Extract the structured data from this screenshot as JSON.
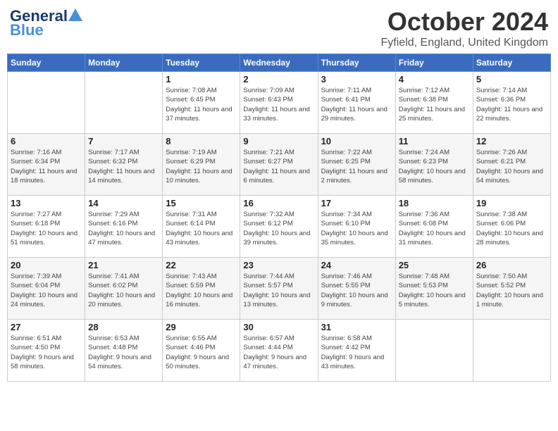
{
  "header": {
    "logo_general": "General",
    "logo_blue": "Blue",
    "month_title": "October 2024",
    "location": "Fyfield, England, United Kingdom"
  },
  "days_of_week": [
    "Sunday",
    "Monday",
    "Tuesday",
    "Wednesday",
    "Thursday",
    "Friday",
    "Saturday"
  ],
  "weeks": [
    [
      {
        "day": "",
        "info": ""
      },
      {
        "day": "",
        "info": ""
      },
      {
        "day": "1",
        "info": "Sunrise: 7:08 AM\nSunset: 6:45 PM\nDaylight: 11 hours\nand 37 minutes."
      },
      {
        "day": "2",
        "info": "Sunrise: 7:09 AM\nSunset: 6:43 PM\nDaylight: 11 hours\nand 33 minutes."
      },
      {
        "day": "3",
        "info": "Sunrise: 7:11 AM\nSunset: 6:41 PM\nDaylight: 11 hours\nand 29 minutes."
      },
      {
        "day": "4",
        "info": "Sunrise: 7:12 AM\nSunset: 6:38 PM\nDaylight: 11 hours\nand 25 minutes."
      },
      {
        "day": "5",
        "info": "Sunrise: 7:14 AM\nSunset: 6:36 PM\nDaylight: 11 hours\nand 22 minutes."
      }
    ],
    [
      {
        "day": "6",
        "info": "Sunrise: 7:16 AM\nSunset: 6:34 PM\nDaylight: 11 hours\nand 18 minutes."
      },
      {
        "day": "7",
        "info": "Sunrise: 7:17 AM\nSunset: 6:32 PM\nDaylight: 11 hours\nand 14 minutes."
      },
      {
        "day": "8",
        "info": "Sunrise: 7:19 AM\nSunset: 6:29 PM\nDaylight: 11 hours\nand 10 minutes."
      },
      {
        "day": "9",
        "info": "Sunrise: 7:21 AM\nSunset: 6:27 PM\nDaylight: 11 hours\nand 6 minutes."
      },
      {
        "day": "10",
        "info": "Sunrise: 7:22 AM\nSunset: 6:25 PM\nDaylight: 11 hours\nand 2 minutes."
      },
      {
        "day": "11",
        "info": "Sunrise: 7:24 AM\nSunset: 6:23 PM\nDaylight: 10 hours\nand 58 minutes."
      },
      {
        "day": "12",
        "info": "Sunrise: 7:26 AM\nSunset: 6:21 PM\nDaylight: 10 hours\nand 54 minutes."
      }
    ],
    [
      {
        "day": "13",
        "info": "Sunrise: 7:27 AM\nSunset: 6:18 PM\nDaylight: 10 hours\nand 51 minutes."
      },
      {
        "day": "14",
        "info": "Sunrise: 7:29 AM\nSunset: 6:16 PM\nDaylight: 10 hours\nand 47 minutes."
      },
      {
        "day": "15",
        "info": "Sunrise: 7:31 AM\nSunset: 6:14 PM\nDaylight: 10 hours\nand 43 minutes."
      },
      {
        "day": "16",
        "info": "Sunrise: 7:32 AM\nSunset: 6:12 PM\nDaylight: 10 hours\nand 39 minutes."
      },
      {
        "day": "17",
        "info": "Sunrise: 7:34 AM\nSunset: 6:10 PM\nDaylight: 10 hours\nand 35 minutes."
      },
      {
        "day": "18",
        "info": "Sunrise: 7:36 AM\nSunset: 6:08 PM\nDaylight: 10 hours\nand 31 minutes."
      },
      {
        "day": "19",
        "info": "Sunrise: 7:38 AM\nSunset: 6:06 PM\nDaylight: 10 hours\nand 28 minutes."
      }
    ],
    [
      {
        "day": "20",
        "info": "Sunrise: 7:39 AM\nSunset: 6:04 PM\nDaylight: 10 hours\nand 24 minutes."
      },
      {
        "day": "21",
        "info": "Sunrise: 7:41 AM\nSunset: 6:02 PM\nDaylight: 10 hours\nand 20 minutes."
      },
      {
        "day": "22",
        "info": "Sunrise: 7:43 AM\nSunset: 5:59 PM\nDaylight: 10 hours\nand 16 minutes."
      },
      {
        "day": "23",
        "info": "Sunrise: 7:44 AM\nSunset: 5:57 PM\nDaylight: 10 hours\nand 13 minutes."
      },
      {
        "day": "24",
        "info": "Sunrise: 7:46 AM\nSunset: 5:55 PM\nDaylight: 10 hours\nand 9 minutes."
      },
      {
        "day": "25",
        "info": "Sunrise: 7:48 AM\nSunset: 5:53 PM\nDaylight: 10 hours\nand 5 minutes."
      },
      {
        "day": "26",
        "info": "Sunrise: 7:50 AM\nSunset: 5:52 PM\nDaylight: 10 hours\nand 1 minute."
      }
    ],
    [
      {
        "day": "27",
        "info": "Sunrise: 6:51 AM\nSunset: 4:50 PM\nDaylight: 9 hours\nand 58 minutes."
      },
      {
        "day": "28",
        "info": "Sunrise: 6:53 AM\nSunset: 4:48 PM\nDaylight: 9 hours\nand 54 minutes."
      },
      {
        "day": "29",
        "info": "Sunrise: 6:55 AM\nSunset: 4:46 PM\nDaylight: 9 hours\nand 50 minutes."
      },
      {
        "day": "30",
        "info": "Sunrise: 6:57 AM\nSunset: 4:44 PM\nDaylight: 9 hours\nand 47 minutes."
      },
      {
        "day": "31",
        "info": "Sunrise: 6:58 AM\nSunset: 4:42 PM\nDaylight: 9 hours\nand 43 minutes."
      },
      {
        "day": "",
        "info": ""
      },
      {
        "day": "",
        "info": ""
      }
    ]
  ]
}
